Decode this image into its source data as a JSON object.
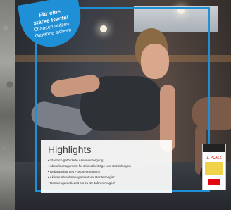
{
  "badge": {
    "line1": "Für eine",
    "line2": "starke Rente!",
    "line3": "Chancen nutzen,",
    "line4": "Gewinne sichern"
  },
  "panel": {
    "title": "Highlights",
    "items": [
      "Staatlich geförderte Altersversorgung",
      "Ablaufmanagement für Einmalbeiträge und Zuzahlungen",
      "Rebalancing des Fondsvermögens",
      "Aktives Ablaufmanagement vor Rentenbeginn",
      "Renteengarantiezeit bis zu 40 Jahren möglich"
    ]
  },
  "seal": {
    "place": "1. PLATZ"
  },
  "colors": {
    "accent": "#1f8fd6",
    "panel_bg": "#ffffff",
    "seal_red": "#d32d25"
  }
}
